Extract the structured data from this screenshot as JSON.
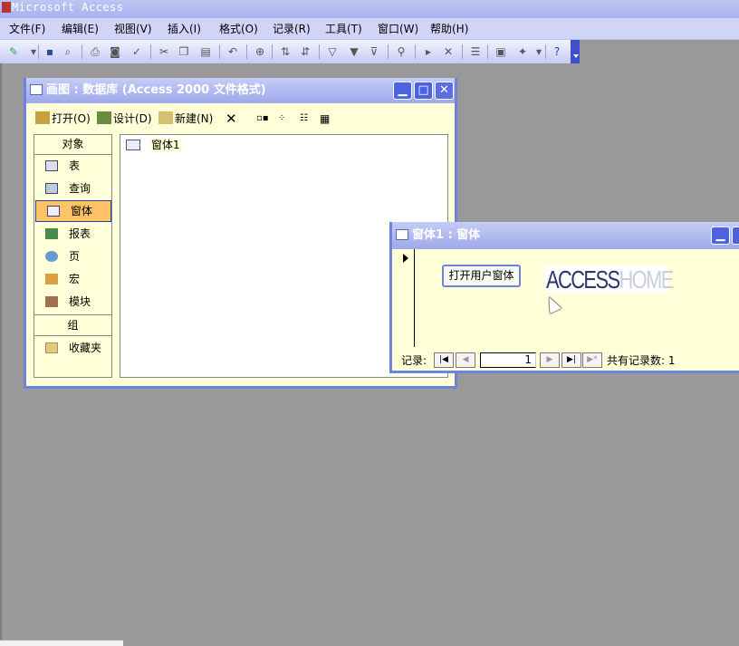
{
  "app": {
    "title": "Microsoft Access"
  },
  "menu": [
    "文件(F)",
    "编辑(E)",
    "视图(V)",
    "插入(I)",
    "格式(O)",
    "记录(R)",
    "工具(T)",
    "窗口(W)",
    "帮助(H)"
  ],
  "db_window": {
    "title": "画图 : 数据库 (Access 2000 文件格式)",
    "toolbar": {
      "open": "打开(O)",
      "design": "设计(D)",
      "new": "新建(N)"
    },
    "objects_header": "对象",
    "objects": [
      "表",
      "查询",
      "窗体",
      "报表",
      "页",
      "宏",
      "模块"
    ],
    "selected_object": "窗体",
    "groups_header": "组",
    "favorites": "收藏夹",
    "items": [
      "窗体1"
    ]
  },
  "form_window": {
    "title": "窗体1 : 窗体",
    "button_label": "打开用户窗体",
    "logo": {
      "part1": "ACCESS",
      "part2": "HOME"
    },
    "nav": {
      "record_label": "记录:",
      "current_record": "1",
      "total_label": "共有记录数: 1"
    }
  },
  "colors": {
    "title_bar": "#a8b2ee",
    "window_border": "#6e83db",
    "pane_bg": "#ffffd8",
    "desktop": "#999999",
    "selected": "#ffc266"
  }
}
